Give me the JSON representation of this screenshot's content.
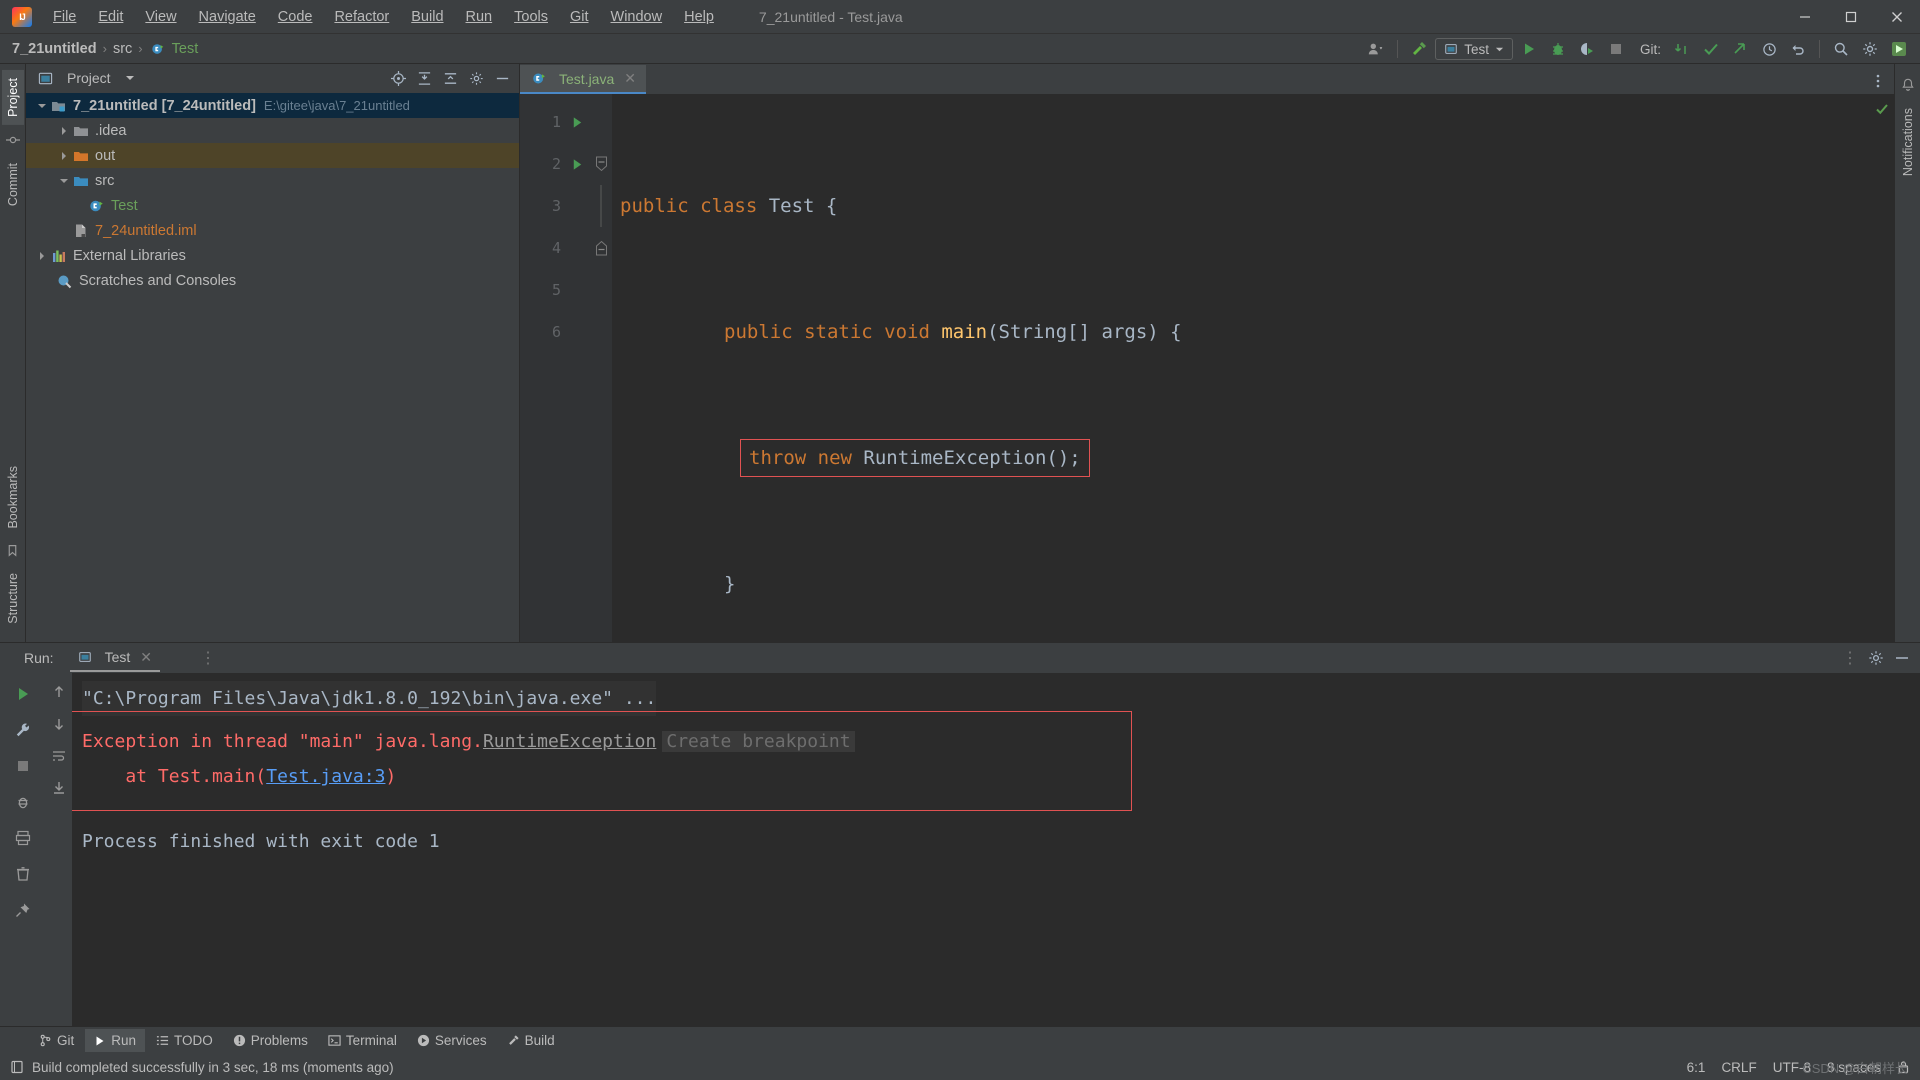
{
  "window": {
    "title": "7_21untitled - Test.java",
    "logo_text": "IJ",
    "controls": {
      "minimize": "—",
      "maximize": "❐",
      "close": "✕"
    }
  },
  "menu": [
    {
      "label": "File",
      "name": "menu-file"
    },
    {
      "label": "Edit",
      "name": "menu-edit"
    },
    {
      "label": "View",
      "name": "menu-view"
    },
    {
      "label": "Navigate",
      "name": "menu-navigate"
    },
    {
      "label": "Code",
      "name": "menu-code"
    },
    {
      "label": "Refactor",
      "name": "menu-refactor"
    },
    {
      "label": "Build",
      "name": "menu-build"
    },
    {
      "label": "Run",
      "name": "menu-run"
    },
    {
      "label": "Tools",
      "name": "menu-tools"
    },
    {
      "label": "Git",
      "name": "menu-git"
    },
    {
      "label": "Window",
      "name": "menu-window"
    },
    {
      "label": "Help",
      "name": "menu-help"
    }
  ],
  "navbar": {
    "breadcrumb": [
      {
        "label": "7_21untitled",
        "style": "bold"
      },
      {
        "label": "src",
        "style": "normal"
      },
      {
        "label": "Test",
        "style": "green"
      }
    ],
    "separator": "›",
    "run_config": "Test",
    "git_label": "Git:"
  },
  "project_panel": {
    "title": "Project",
    "tree": [
      {
        "label": "7_21untitled [7_24untitled]",
        "path": "E:\\gitee\\java\\7_21untitled",
        "indent": 0,
        "twist": "expanded",
        "icon": "module-icon",
        "style": "bold",
        "selected": "blue"
      },
      {
        "label": ".idea",
        "indent": 1,
        "twist": "collapsed",
        "icon": "folder-gray-icon",
        "style": "normal",
        "selected": "none"
      },
      {
        "label": "out",
        "indent": 1,
        "twist": "collapsed",
        "icon": "folder-orange-icon",
        "style": "normal",
        "selected": "brown"
      },
      {
        "label": "src",
        "indent": 1,
        "twist": "expanded",
        "icon": "folder-blue-icon",
        "style": "normal",
        "selected": "none"
      },
      {
        "label": "Test",
        "indent": 2,
        "twist": "none",
        "icon": "java-class-icon",
        "style": "green",
        "selected": "none"
      },
      {
        "label": "7_24untitled.iml",
        "indent": 1,
        "twist": "none",
        "icon": "iml-file-icon",
        "style": "red",
        "selected": "none"
      },
      {
        "label": "External Libraries",
        "indent": 0,
        "twist": "collapsed",
        "icon": "libraries-icon",
        "style": "normal",
        "selected": "none"
      },
      {
        "label": "Scratches and Consoles",
        "indent": 0,
        "twist": "none",
        "icon": "scratches-icon",
        "style": "normal",
        "selected": "none"
      }
    ]
  },
  "left_strip": {
    "tabs": [
      "Project"
    ],
    "labels": [
      "Commit"
    ]
  },
  "right_strip": {
    "labels": [
      "Notifications"
    ]
  },
  "bottom_left_strip": {
    "labels": [
      "Bookmarks",
      "Structure"
    ]
  },
  "editor": {
    "tab": {
      "label": "Test.java",
      "close": "✕"
    },
    "lines": [
      {
        "num": "1",
        "runnable": true,
        "fold": "none"
      },
      {
        "num": "2",
        "runnable": true,
        "fold": "minus"
      },
      {
        "num": "3",
        "runnable": false,
        "fold": "bar"
      },
      {
        "num": "4",
        "runnable": false,
        "fold": "end"
      },
      {
        "num": "5",
        "runnable": false,
        "fold": "none"
      },
      {
        "num": "6",
        "runnable": false,
        "fold": "none"
      }
    ],
    "code_text": {
      "l1_a": "public class ",
      "l1_b": "Test",
      "l1_c": " {",
      "l2_a": "public static void ",
      "l2_b": "main",
      "l2_c": "(String[] args) {",
      "l3_a": "throw new ",
      "l3_b": "RuntimeException",
      "l3_c": "();",
      "l4": "}",
      "l5": "}"
    }
  },
  "run_panel": {
    "header_label": "Run:",
    "tab_label": "Test",
    "tab_close": "✕",
    "console": {
      "command": "\"C:\\Program Files\\Java\\jdk1.8.0_192\\bin\\java.exe\" ...",
      "exception_prefix": "Exception in thread \"main\" java.lang.",
      "exception_link": "RuntimeException",
      "breakpoint_hint": "Create breakpoint",
      "stack_at": "    at Test.main(",
      "stack_link": "Test.java:3",
      "stack_close": ")",
      "process_result": "Process finished with exit code 1"
    }
  },
  "tool_window_bar": [
    {
      "label": "Git",
      "icon": "git-branch-icon",
      "active": false
    },
    {
      "label": "Run",
      "icon": "run-play-icon",
      "active": true
    },
    {
      "label": "TODO",
      "icon": "todo-list-icon",
      "active": false
    },
    {
      "label": "Problems",
      "icon": "problems-icon",
      "active": false
    },
    {
      "label": "Terminal",
      "icon": "terminal-icon",
      "active": false
    },
    {
      "label": "Services",
      "icon": "services-icon",
      "active": false
    },
    {
      "label": "Build",
      "icon": "build-hammer-icon",
      "active": false
    }
  ],
  "statusbar": {
    "message": "Build completed successfully in 3 sec, 18 ms (moments ago)",
    "caret_position": "6:1",
    "line_separator": "CRLF",
    "encoding": "UTF-8",
    "indent": "8 spaces",
    "watermark": "CSDN @白朝样长"
  },
  "colors": {
    "accent_blue": "#4a88c7",
    "error_red": "#ff6b68",
    "error_border": "#e05252",
    "keyword_orange": "#cc7832",
    "method_yellow": "#ffc66d",
    "green_run": "#499c54",
    "link_blue": "#589df6",
    "panel_bg": "#3c3f41",
    "editor_bg": "#2b2b2b",
    "gutter_bg": "#313335",
    "selection_blue": "#0d293e",
    "selection_brown": "#4e4428"
  }
}
